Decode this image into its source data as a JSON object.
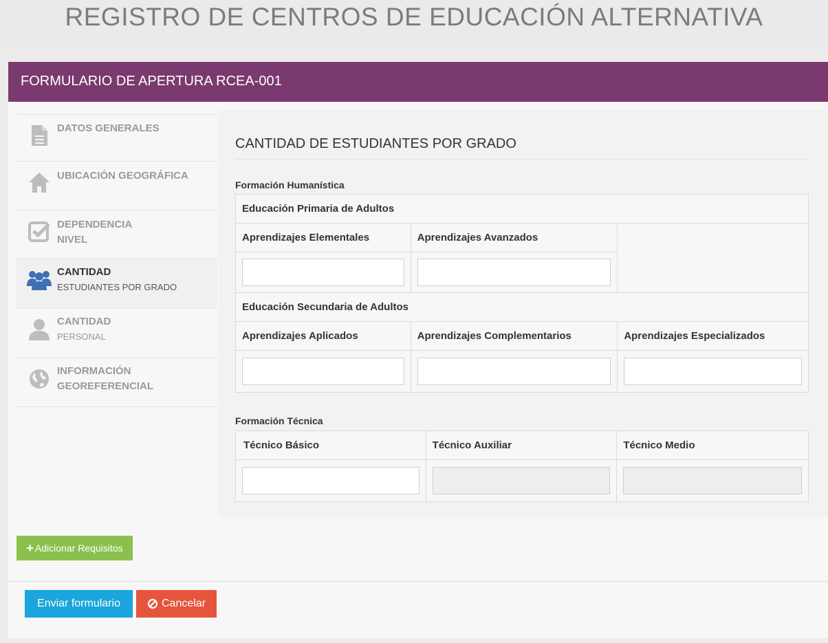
{
  "page": {
    "title": "REGISTRO DE CENTROS DE EDUCACIÓN ALTERNATIVA"
  },
  "panel": {
    "heading": "FORMULARIO DE APERTURA RCEA-001"
  },
  "sidebar": {
    "items": [
      {
        "line1": "DATOS GENERALES",
        "line2": "",
        "icon": "document-icon"
      },
      {
        "line1": "UBICACIÓN GEOGRÁFICA",
        "line2": "",
        "icon": "home-icon"
      },
      {
        "line1": "DEPENDENCIA",
        "line2": "NIVEL",
        "icon": "checkbox-icon"
      },
      {
        "line1": "CANTIDAD",
        "line2": "ESTUDIANTES POR GRADO",
        "icon": "users-icon",
        "active": true
      },
      {
        "line1": "CANTIDAD",
        "line2": "PERSONAL",
        "icon": "user-icon"
      },
      {
        "line1": "INFORMACIÓN",
        "line2": "GEOREFERENCIAL",
        "icon": "globe-icon"
      }
    ]
  },
  "content": {
    "section_title": "CANTIDAD DE ESTUDIANTES POR GRADO",
    "humanistica": {
      "label": "Formación Humanística",
      "primaria": {
        "title": "Educación Primaria de Adultos",
        "cols": [
          "Aprendizajes Elementales",
          "Aprendizajes Avanzados"
        ]
      },
      "secundaria": {
        "title": "Educación Secundaria de Adultos",
        "cols": [
          "Aprendizajes Aplicados",
          "Aprendizajes Complementarios",
          "Aprendizajes Especializados"
        ]
      }
    },
    "tecnica": {
      "label": "Formación Técnica",
      "cols": [
        "Técnico Básico",
        "Técnico Auxiliar",
        "Técnico Medio"
      ]
    }
  },
  "buttons": {
    "add_requirements": "Adicionar Requisitos",
    "send": "Enviar formulario",
    "cancel": "Cancelar"
  },
  "colors": {
    "heading_bg": "#7b3a6f",
    "add_button": "#8bc04f",
    "send_button": "#1aa5dc",
    "cancel_button": "#e5553b",
    "active_icon": "#3f6fb5"
  }
}
